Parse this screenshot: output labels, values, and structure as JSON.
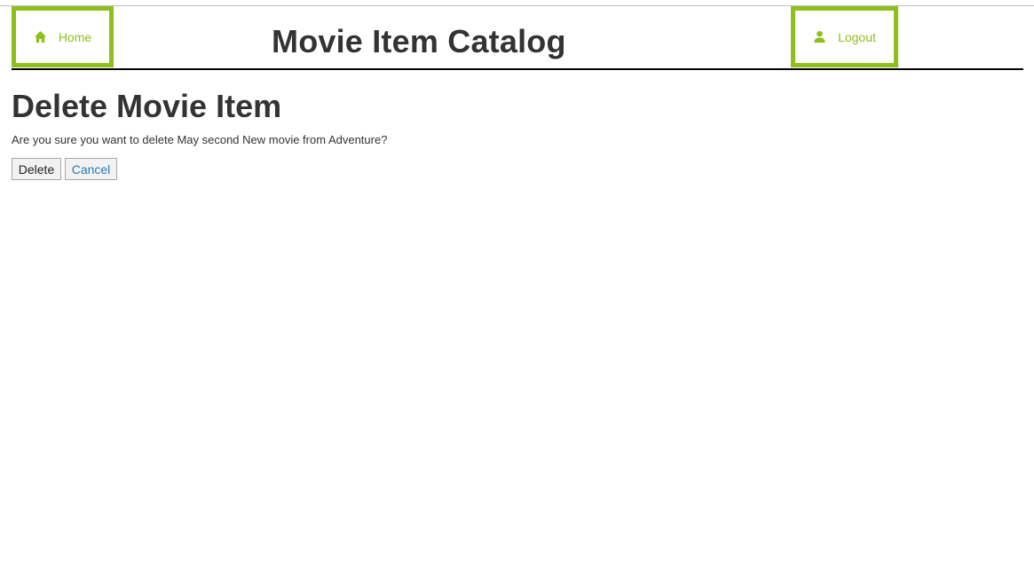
{
  "header": {
    "home_label": "Home",
    "home_icon": "home-icon",
    "title": "Movie Item Catalog",
    "logout_label": "Logout",
    "logout_icon": "user-icon"
  },
  "main": {
    "heading": "Delete Movie Item",
    "confirm_message": "Are you sure you want to delete May second New movie from Adventure?",
    "delete_label": "Delete",
    "cancel_label": "Cancel"
  },
  "colors": {
    "accent": "#8fbf1a",
    "text": "#333333",
    "link": "#2a7ab8"
  }
}
